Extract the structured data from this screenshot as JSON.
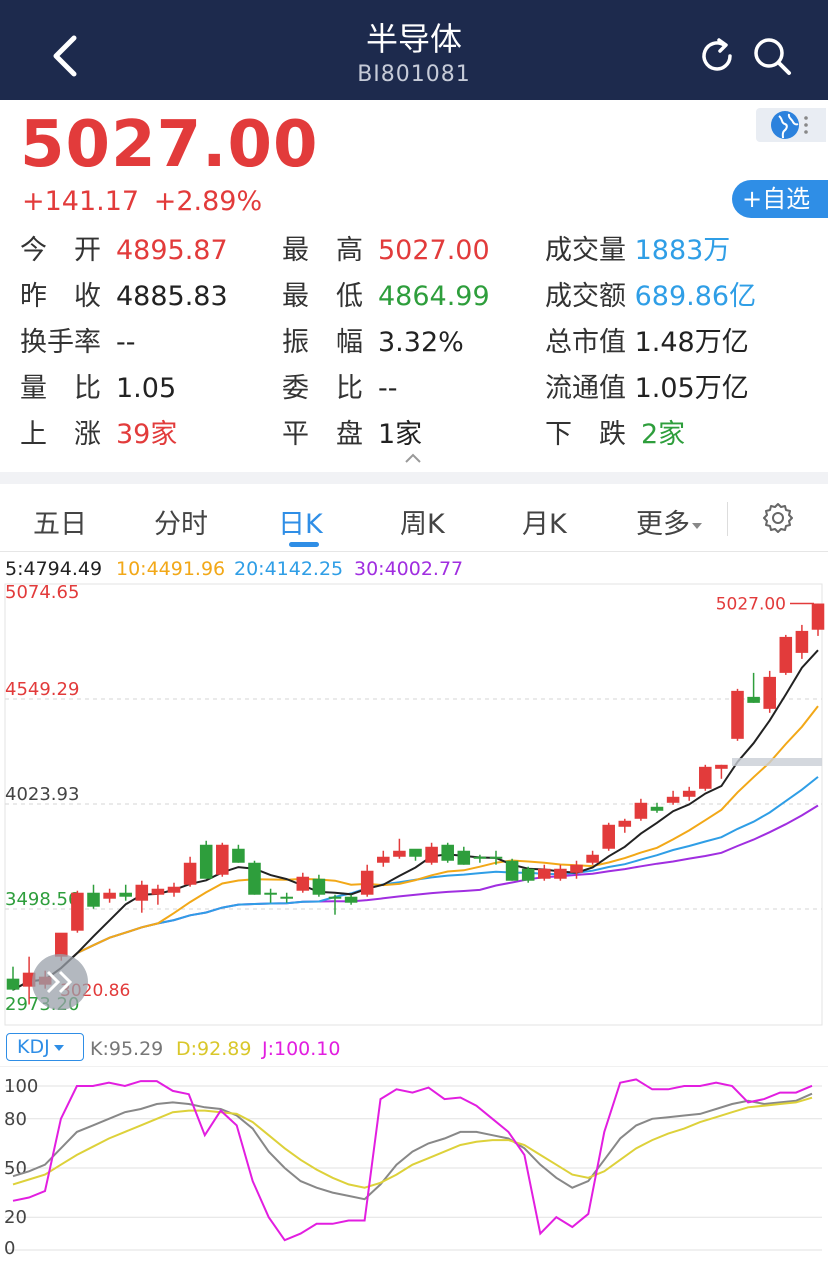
{
  "header": {
    "title": "半导体",
    "code": "BI801081"
  },
  "quote": {
    "price": "5027.00",
    "change": "+141.17",
    "change_pct": "+2.89%",
    "watchlist_label": "+自选"
  },
  "stats": {
    "open_label": "今　开",
    "open": "4895.87",
    "high_label": "最　高",
    "high": "5027.00",
    "volume_label": "成交量",
    "volume": "1883万",
    "prev_close_label": "昨　收",
    "prev_close": "4885.83",
    "low_label": "最　低",
    "low": "4864.99",
    "amount_label": "成交额",
    "amount": "689.86亿",
    "turnover_label": "换手率",
    "turnover": "--",
    "amplitude_label": "振　幅",
    "amplitude": "3.32%",
    "market_cap_label": "总市值",
    "market_cap": "1.48万亿",
    "vol_ratio_label": "量　比",
    "vol_ratio": "1.05",
    "commission_label": "委　比",
    "commission": "--",
    "float_cap_label": "流通值",
    "float_cap": "1.05万亿",
    "up_label": "上　涨",
    "up": "39家",
    "flat_label": "平　盘",
    "flat": "1家",
    "down_label": "下　跌",
    "down": "2家"
  },
  "tabs": [
    "五日",
    "分时",
    "日K",
    "周K",
    "月K",
    "更多"
  ],
  "active_tab": "日K",
  "ma_legend": {
    "ma5": "5:4794.49",
    "ma10": "10:4491.96",
    "ma20": "20:4142.25",
    "ma30": "30:4002.77"
  },
  "colors": {
    "header_bg": "#1d2a4d",
    "up": "#e23b3b",
    "down": "#2e9e3c",
    "accent": "#2f8ee6",
    "ma5": "#222222",
    "ma10": "#f2a818",
    "ma20": "#2f9ee6",
    "ma30": "#a02ee0"
  },
  "chart_data": [
    {
      "type": "candlestick",
      "ylim": [
        2973.2,
        5074.65
      ],
      "y_ticks": [
        "5074.65",
        "4549.29",
        "4023.93",
        "3498.56",
        "2973.20"
      ],
      "max_label": "5027.00",
      "min_label": "3020.86",
      "candles": [
        {
          "o": 3150,
          "h": 3210,
          "l": 3090,
          "c": 3095
        },
        {
          "o": 3110,
          "h": 3260,
          "l": 3020.86,
          "c": 3180
        },
        {
          "o": 3120,
          "h": 3190,
          "l": 3100,
          "c": 3160
        },
        {
          "o": 3260,
          "h": 3350,
          "l": 3240,
          "c": 3380
        },
        {
          "o": 3390,
          "h": 3590,
          "l": 3380,
          "c": 3580
        },
        {
          "o": 3580,
          "h": 3620,
          "l": 3500,
          "c": 3510
        },
        {
          "o": 3550,
          "h": 3600,
          "l": 3530,
          "c": 3580
        },
        {
          "o": 3580,
          "h": 3620,
          "l": 3540,
          "c": 3560
        },
        {
          "o": 3540,
          "h": 3640,
          "l": 3480,
          "c": 3620
        },
        {
          "o": 3570,
          "h": 3620,
          "l": 3520,
          "c": 3600
        },
        {
          "o": 3580,
          "h": 3630,
          "l": 3560,
          "c": 3610
        },
        {
          "o": 3620,
          "h": 3760,
          "l": 3610,
          "c": 3730
        },
        {
          "o": 3820,
          "h": 3840,
          "l": 3650,
          "c": 3650
        },
        {
          "o": 3670,
          "h": 3830,
          "l": 3660,
          "c": 3820
        },
        {
          "o": 3800,
          "h": 3820,
          "l": 3730,
          "c": 3730
        },
        {
          "o": 3730,
          "h": 3740,
          "l": 3570,
          "c": 3570
        },
        {
          "o": 3580,
          "h": 3600,
          "l": 3530,
          "c": 3570
        },
        {
          "o": 3560,
          "h": 3580,
          "l": 3530,
          "c": 3550
        },
        {
          "o": 3590,
          "h": 3680,
          "l": 3580,
          "c": 3660
        },
        {
          "o": 3650,
          "h": 3670,
          "l": 3560,
          "c": 3570
        },
        {
          "o": 3560,
          "h": 3570,
          "l": 3470,
          "c": 3550
        },
        {
          "o": 3560,
          "h": 3570,
          "l": 3520,
          "c": 3530
        },
        {
          "o": 3570,
          "h": 3720,
          "l": 3560,
          "c": 3690
        },
        {
          "o": 3730,
          "h": 3790,
          "l": 3710,
          "c": 3760
        },
        {
          "o": 3760,
          "h": 3850,
          "l": 3750,
          "c": 3790
        },
        {
          "o": 3800,
          "h": 3790,
          "l": 3740,
          "c": 3760
        },
        {
          "o": 3730,
          "h": 3830,
          "l": 3720,
          "c": 3810
        },
        {
          "o": 3820,
          "h": 3830,
          "l": 3730,
          "c": 3740
        },
        {
          "o": 3790,
          "h": 3810,
          "l": 3720,
          "c": 3720
        },
        {
          "o": 3760,
          "h": 3770,
          "l": 3730,
          "c": 3750
        },
        {
          "o": 3760,
          "h": 3790,
          "l": 3720,
          "c": 3750
        },
        {
          "o": 3740,
          "h": 3750,
          "l": 3640,
          "c": 3640
        },
        {
          "o": 3700,
          "h": 3710,
          "l": 3630,
          "c": 3640
        },
        {
          "o": 3650,
          "h": 3720,
          "l": 3640,
          "c": 3700
        },
        {
          "o": 3650,
          "h": 3720,
          "l": 3640,
          "c": 3700
        },
        {
          "o": 3680,
          "h": 3740,
          "l": 3650,
          "c": 3720
        },
        {
          "o": 3730,
          "h": 3790,
          "l": 3720,
          "c": 3770
        },
        {
          "o": 3800,
          "h": 3930,
          "l": 3790,
          "c": 3920
        },
        {
          "o": 3910,
          "h": 3950,
          "l": 3880,
          "c": 3940
        },
        {
          "o": 3950,
          "h": 4050,
          "l": 3940,
          "c": 4030
        },
        {
          "o": 4010,
          "h": 4030,
          "l": 3980,
          "c": 3990
        },
        {
          "o": 4030,
          "h": 4090,
          "l": 4020,
          "c": 4060
        },
        {
          "o": 4060,
          "h": 4110,
          "l": 4040,
          "c": 4090
        },
        {
          "o": 4100,
          "h": 4220,
          "l": 4090,
          "c": 4210
        },
        {
          "o": 4200,
          "h": 4220,
          "l": 4150,
          "c": 4220
        },
        {
          "o": 4350,
          "h": 4600,
          "l": 4340,
          "c": 4590
        },
        {
          "o": 4560,
          "h": 4680,
          "l": 4530,
          "c": 4530
        },
        {
          "o": 4500,
          "h": 4690,
          "l": 4480,
          "c": 4660
        },
        {
          "o": 4680,
          "h": 4870,
          "l": 4670,
          "c": 4860
        },
        {
          "o": 4780,
          "h": 4920,
          "l": 4750,
          "c": 4890
        },
        {
          "o": 4895.87,
          "h": 5027.0,
          "l": 4864.99,
          "c": 5027.0
        }
      ]
    },
    {
      "type": "line",
      "name": "KDJ",
      "ylim": [
        0,
        100
      ],
      "y_ticks": [
        "100",
        "80",
        "50",
        "20",
        "0"
      ],
      "legend": {
        "k": "K:95.29",
        "d": "D:92.89",
        "j": "J:100.10"
      },
      "series": [
        {
          "name": "K",
          "values": [
            45,
            48,
            52,
            62,
            72,
            76,
            80,
            84,
            86,
            89,
            90,
            89,
            87,
            86,
            82,
            74,
            60,
            50,
            42,
            38,
            35,
            33,
            31,
            40,
            52,
            60,
            65,
            68,
            72,
            72,
            70,
            68,
            62,
            52,
            44,
            38,
            42,
            55,
            68,
            76,
            80,
            81,
            82,
            83,
            86,
            89,
            91,
            89,
            90,
            91,
            95.29
          ]
        },
        {
          "name": "D",
          "values": [
            40,
            43,
            46,
            52,
            58,
            63,
            68,
            72,
            76,
            80,
            84,
            85,
            85,
            84,
            83,
            78,
            70,
            62,
            55,
            49,
            44,
            40,
            38,
            41,
            46,
            52,
            56,
            60,
            64,
            66,
            67,
            67,
            64,
            58,
            52,
            46,
            44,
            48,
            55,
            62,
            67,
            71,
            74,
            78,
            81,
            84,
            87,
            88,
            89,
            90,
            92.89
          ]
        },
        {
          "name": "J",
          "values": [
            30,
            32,
            36,
            80,
            100,
            100,
            102,
            100,
            103,
            103,
            97,
            95,
            70,
            85,
            76,
            42,
            20,
            6,
            10,
            16,
            16,
            18,
            18,
            92,
            98,
            96,
            99,
            92,
            93,
            88,
            80,
            72,
            58,
            10,
            20,
            14,
            22,
            72,
            102,
            104,
            98,
            98,
            100,
            100,
            102,
            100,
            90,
            92,
            96,
            96,
            100.1
          ]
        }
      ]
    }
  ]
}
